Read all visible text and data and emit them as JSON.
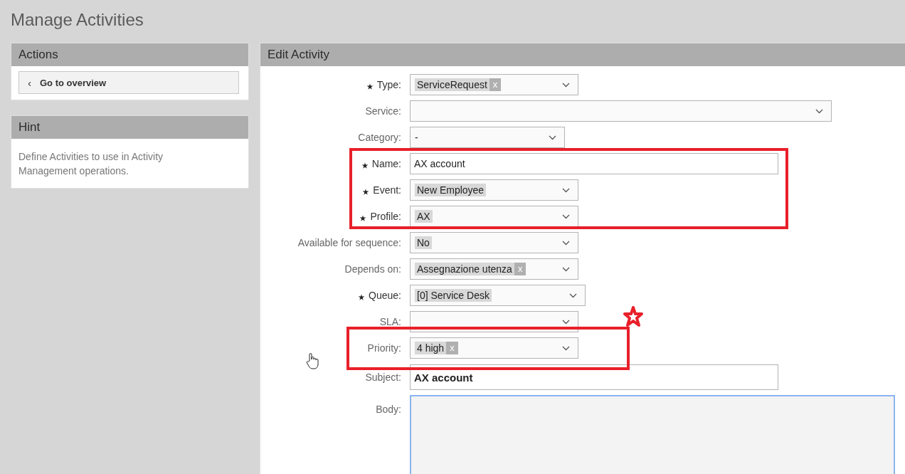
{
  "page_title": "Manage Activities",
  "actions": {
    "title": "Actions",
    "button": {
      "icon": "‹",
      "label": "Go to overview"
    }
  },
  "hint": {
    "title": "Hint",
    "text": "Define Activities to use in Activity Management operations."
  },
  "edit": {
    "title": "Edit Activity",
    "fields": [
      {
        "label": "Type:",
        "required": true,
        "kind": "select",
        "tags": [
          {
            "text": "ServiceRequest",
            "remove": "x"
          }
        ]
      },
      {
        "label": "Service:",
        "required": false,
        "kind": "select"
      },
      {
        "label": "Category:",
        "required": false,
        "kind": "plain-select",
        "value": "-"
      },
      {
        "label": "Name:",
        "required": true,
        "kind": "text",
        "value": "AX account"
      },
      {
        "label": "Event:",
        "required": true,
        "kind": "select",
        "tags": [
          {
            "text": "New Employee"
          }
        ]
      },
      {
        "label": "Profile:",
        "required": true,
        "kind": "select",
        "tags": [
          {
            "text": "AX"
          }
        ]
      },
      {
        "label": "Available for sequence:",
        "required": false,
        "kind": "select",
        "tags": [
          {
            "text": "No"
          }
        ]
      },
      {
        "label": "Depends on:",
        "required": false,
        "kind": "select",
        "tags": [
          {
            "text": "Assegnazione utenza",
            "remove": "x"
          }
        ]
      },
      {
        "label": "Queue:",
        "required": true,
        "kind": "select",
        "tags": [
          {
            "text": "[0] Service Desk"
          }
        ]
      },
      {
        "label": "SLA:",
        "required": false,
        "kind": "select"
      },
      {
        "label": "Priority:",
        "required": false,
        "kind": "select",
        "tags": [
          {
            "text": "4 high",
            "remove": "x"
          }
        ]
      },
      {
        "label": "Subject:",
        "required": false,
        "kind": "subject",
        "value": "AX account"
      },
      {
        "label": "Body:",
        "required": false,
        "kind": "textarea"
      }
    ]
  }
}
